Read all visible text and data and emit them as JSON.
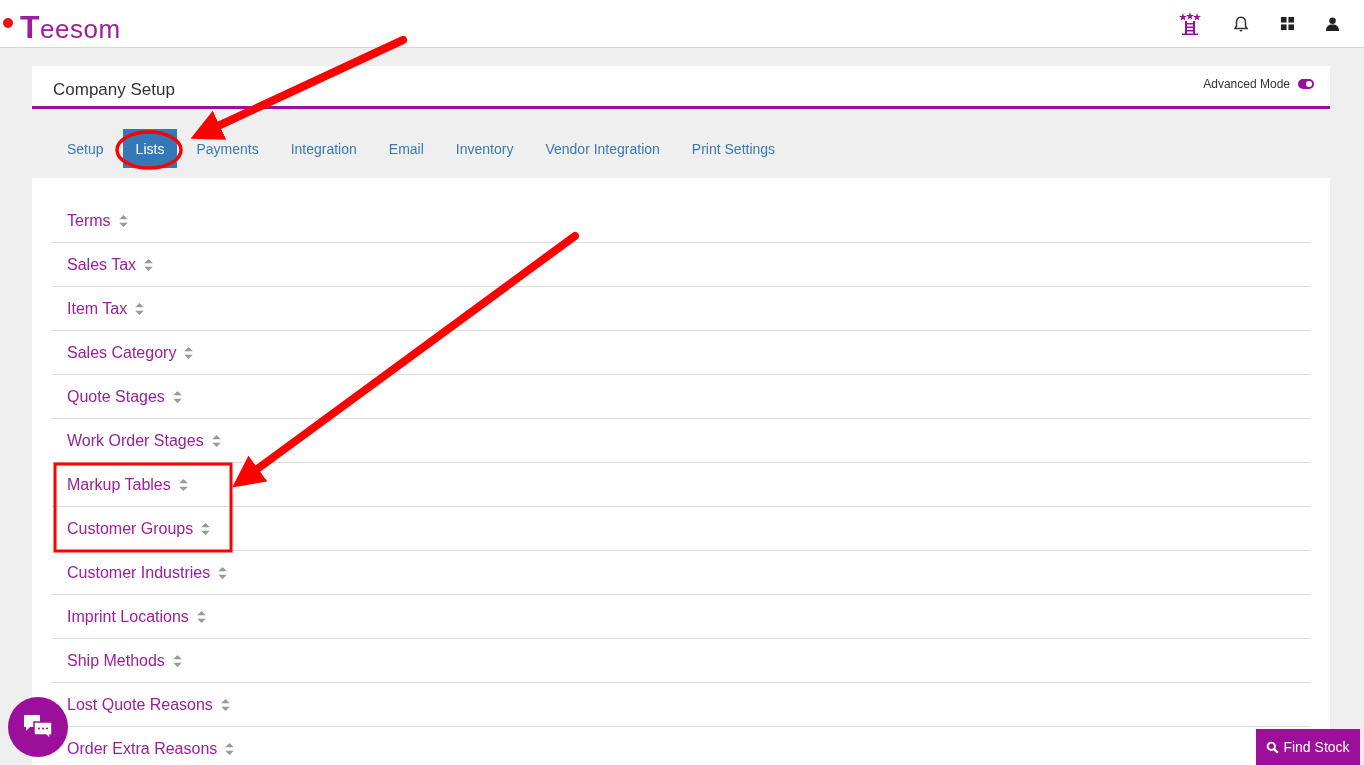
{
  "header": {
    "logo": "Teesom"
  },
  "page": {
    "title": "Company Setup",
    "advanced_mode": {
      "label": "Advanced Mode",
      "on": true
    }
  },
  "tabs": [
    {
      "label": "Setup",
      "selected": false
    },
    {
      "label": "Lists",
      "selected": true
    },
    {
      "label": "Payments",
      "selected": false
    },
    {
      "label": "Integration",
      "selected": false
    },
    {
      "label": "Email",
      "selected": false
    },
    {
      "label": "Inventory",
      "selected": false
    },
    {
      "label": "Vendor Integration",
      "selected": false
    },
    {
      "label": "Print Settings",
      "selected": false
    }
  ],
  "lists": [
    {
      "label": "Terms"
    },
    {
      "label": "Sales Tax"
    },
    {
      "label": "Item Tax"
    },
    {
      "label": "Sales Category"
    },
    {
      "label": "Quote Stages"
    },
    {
      "label": "Work Order Stages"
    },
    {
      "label": "Markup Tables"
    },
    {
      "label": "Customer Groups"
    },
    {
      "label": "Customer Industries"
    },
    {
      "label": "Imprint Locations"
    },
    {
      "label": "Ship Methods"
    },
    {
      "label": "Lost Quote Reasons"
    },
    {
      "label": "Order Extra Reasons"
    }
  ],
  "find_stock_button": "Find Stock"
}
